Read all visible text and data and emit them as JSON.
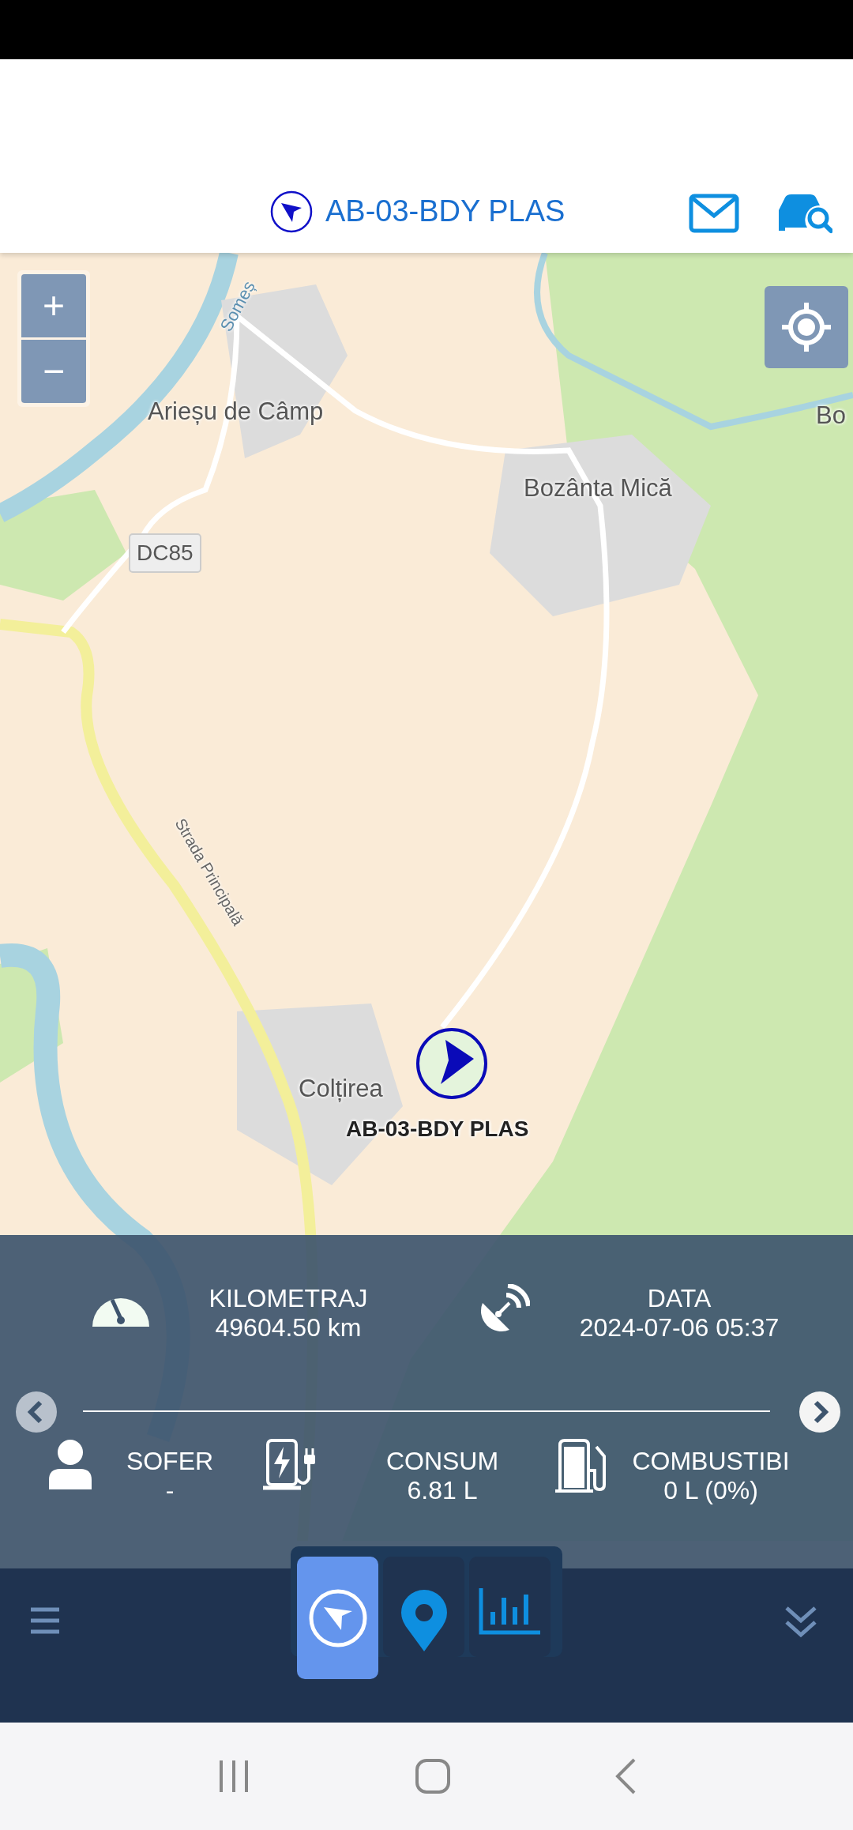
{
  "header": {
    "title": "AB-03-BDY PLAS"
  },
  "map": {
    "zoom_in": "+",
    "zoom_out": "−",
    "labels": [
      {
        "kind": "place",
        "text": "Arieșu de Câmp"
      },
      {
        "kind": "place",
        "text": "Bozânta Mică"
      },
      {
        "kind": "place",
        "text": "Bo"
      },
      {
        "kind": "road",
        "text": "DC85"
      },
      {
        "kind": "street",
        "text": "Strada Principală"
      },
      {
        "kind": "river",
        "text": "Someș"
      },
      {
        "kind": "place",
        "text": "Colțirea"
      }
    ],
    "vehicle_label": "AB-03-BDY PLAS"
  },
  "info_panel": {
    "items": [
      {
        "label": "KILOMETRAJ",
        "value": "49604.50 km"
      },
      {
        "label": "DATA",
        "value": "2024-07-06 05:37"
      },
      {
        "label": "SOFER",
        "value": "-"
      },
      {
        "label": "CONSUM",
        "value": "6.81 L"
      },
      {
        "label": "COMBUSTIBI",
        "value": "0 L (0%)"
      }
    ]
  },
  "tabs": [
    {
      "selected": true
    },
    {
      "selected": false
    },
    {
      "selected": false
    }
  ]
}
